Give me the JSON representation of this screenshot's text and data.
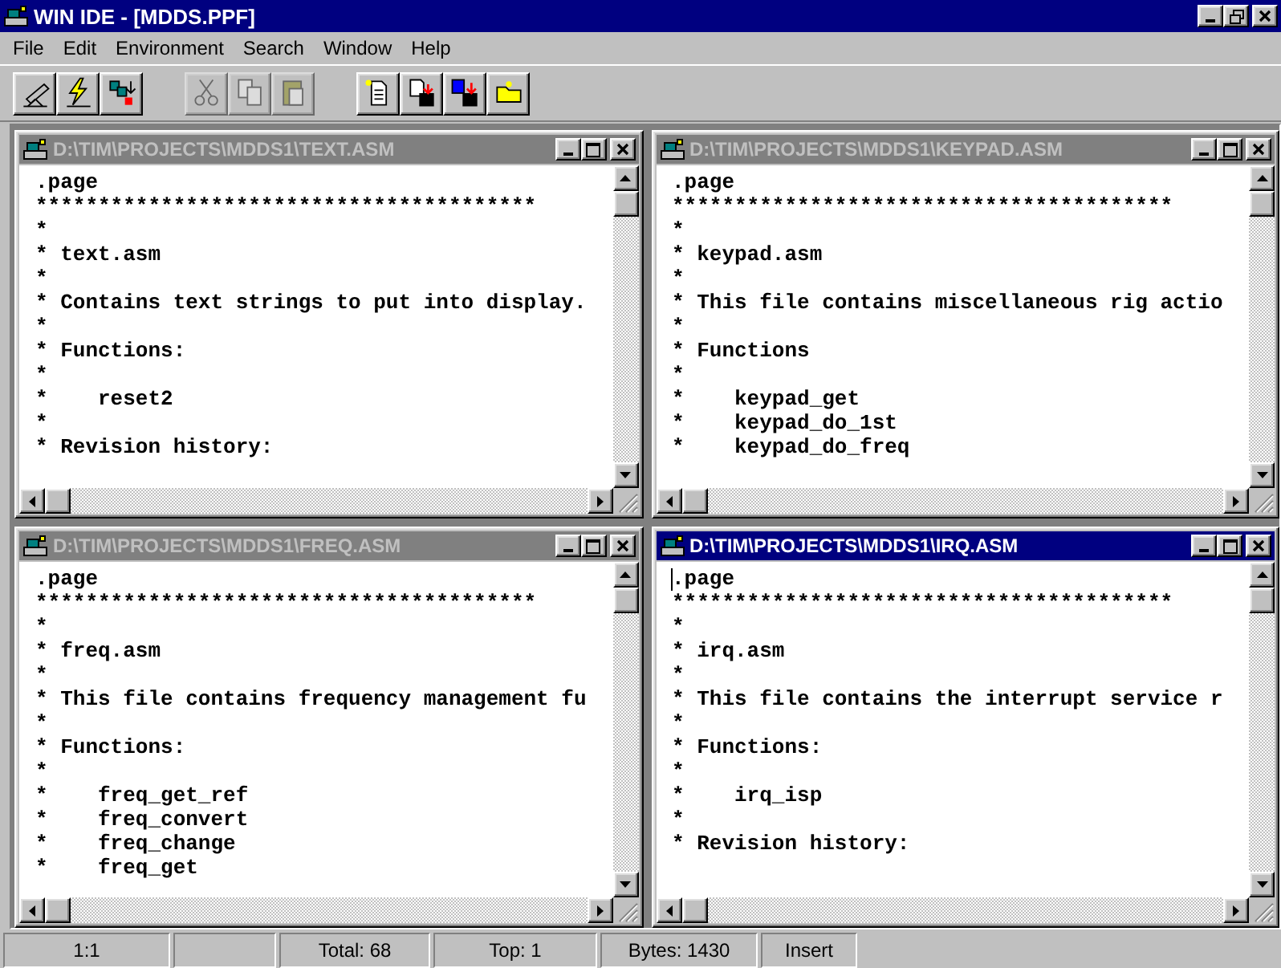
{
  "window": {
    "title": "WIN IDE - [MDDS.PPF]"
  },
  "menu": [
    "File",
    "Edit",
    "Environment",
    "Search",
    "Window",
    "Help"
  ],
  "toolbar": {
    "groups": [
      [
        {
          "disabled": false
        },
        {
          "disabled": false
        },
        {
          "disabled": false
        }
      ],
      [
        {
          "disabled": true
        },
        {
          "disabled": true
        },
        {
          "disabled": true
        }
      ],
      [
        {
          "disabled": false
        },
        {
          "disabled": false
        },
        {
          "disabled": false
        },
        {
          "disabled": false
        }
      ]
    ]
  },
  "documents": [
    {
      "title": "D:\\TIM\\PROJECTS\\MDDS1\\TEXT.ASM",
      "active": false,
      "lines": [
        ".page",
        "****************************************",
        "*",
        "* text.asm",
        "*",
        "* Contains text strings to put into display.",
        "*",
        "* Functions:",
        "*",
        "*    reset2",
        "*",
        "* Revision history:"
      ]
    },
    {
      "title": "D:\\TIM\\PROJECTS\\MDDS1\\KEYPAD.ASM",
      "active": false,
      "lines": [
        ".page",
        "****************************************",
        "*",
        "* keypad.asm",
        "*",
        "* This file contains miscellaneous rig actio",
        "*",
        "* Functions",
        "*",
        "*    keypad_get",
        "*    keypad_do_1st",
        "*    keypad_do_freq"
      ]
    },
    {
      "title": "D:\\TIM\\PROJECTS\\MDDS1\\FREQ.ASM",
      "active": false,
      "lines": [
        ".page",
        "****************************************",
        "*",
        "* freq.asm",
        "*",
        "* This file contains frequency management fu",
        "*",
        "* Functions:",
        "*",
        "*    freq_get_ref",
        "*    freq_convert",
        "*    freq_change",
        "*    freq_get"
      ]
    },
    {
      "title": "D:\\TIM\\PROJECTS\\MDDS1\\IRQ.ASM",
      "active": true,
      "lines": [
        ".page",
        "****************************************",
        "*",
        "* irq.asm",
        "*",
        "* This file contains the interrupt service r",
        "*",
        "* Functions:",
        "*",
        "*    irq_isp",
        "*",
        "* Revision history:"
      ]
    }
  ],
  "status_bar": {
    "panes": [
      {
        "text": "1:1"
      },
      {
        "text": "Total: 68"
      },
      {
        "text": "Top: 1"
      },
      {
        "text": "Bytes: 1430"
      },
      {
        "text": "Insert"
      }
    ]
  }
}
